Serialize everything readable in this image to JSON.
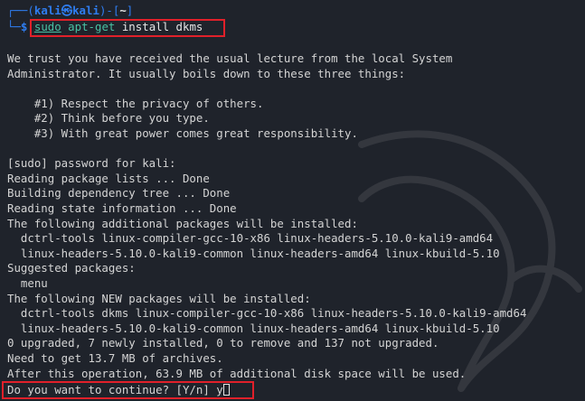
{
  "prompt": {
    "corner_top": "┌──",
    "corner_bottom": "└─",
    "open": "(",
    "user": "kali",
    "at": "㉿",
    "host": "kali",
    "close": ")-[",
    "path": "~",
    "path_close": "]",
    "dollar": "$"
  },
  "command": {
    "sudo": "sudo",
    "rest": " apt-get",
    "args": " install dkms"
  },
  "output": [
    "We trust you have received the usual lecture from the local System",
    "Administrator. It usually boils down to these three things:",
    "",
    "    #1) Respect the privacy of others.",
    "    #2) Think before you type.",
    "    #3) With great power comes great responsibility.",
    "",
    "[sudo] password for kali:",
    "Reading package lists ... Done",
    "Building dependency tree ... Done",
    "Reading state information ... Done",
    "The following additional packages will be installed:",
    "  dctrl-tools linux-compiler-gcc-10-x86 linux-headers-5.10.0-kali9-amd64",
    "  linux-headers-5.10.0-kali9-common linux-headers-amd64 linux-kbuild-5.10",
    "Suggested packages:",
    "  menu",
    "The following NEW packages will be installed:",
    "  dctrl-tools dkms linux-compiler-gcc-10-x86 linux-headers-5.10.0-kali9-amd64",
    "  linux-headers-5.10.0-kali9-common linux-headers-amd64 linux-kbuild-5.10",
    "0 upgraded, 7 newly installed, 0 to remove and 137 not upgraded.",
    "Need to get 13.7 MB of archives.",
    "After this operation, 63.9 MB of additional disk space will be used."
  ],
  "continue_prompt": "Do you want to continue? [Y/n] ",
  "continue_input": "y",
  "colors": {
    "background": "#1f232b",
    "prompt_blue": "#2f7df0",
    "command_teal": "#49c0a3",
    "highlight_red": "#e0202a"
  }
}
